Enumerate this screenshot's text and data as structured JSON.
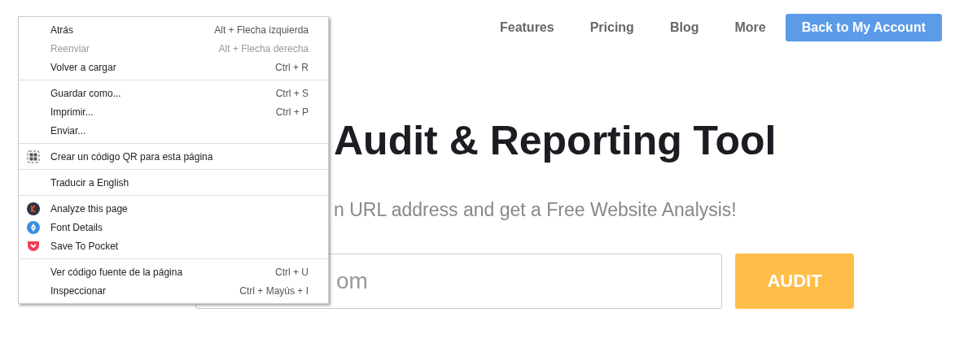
{
  "nav": {
    "links": [
      "Features",
      "Pricing",
      "Blog",
      "More"
    ],
    "account_button": "Back to My Account"
  },
  "hero": {
    "title": "Audit & Reporting Tool",
    "subtitle": "n URL address and get a Free Website Analysis!",
    "url_field": {
      "placeholder": "om"
    },
    "audit_button": "AUDIT"
  },
  "context_menu": {
    "sections": [
      [
        {
          "label": "Atrás",
          "shortcut": "Alt + Flecha izquierda",
          "disabled": false
        },
        {
          "label": "Reenviar",
          "shortcut": "Alt + Flecha derecha",
          "disabled": true
        },
        {
          "label": "Volver a cargar",
          "shortcut": "Ctrl + R",
          "disabled": false
        }
      ],
      [
        {
          "label": "Guardar como...",
          "shortcut": "Ctrl + S",
          "disabled": false
        },
        {
          "label": "Imprimir...",
          "shortcut": "Ctrl + P",
          "disabled": false
        },
        {
          "label": "Enviar...",
          "disabled": false
        }
      ],
      [
        {
          "label": "Crear un código QR para esta página",
          "kind": "qr",
          "disabled": false
        }
      ],
      [
        {
          "label": "Traducir a English",
          "disabled": false
        }
      ],
      [
        {
          "label": "Analyze this page",
          "kind": "k-logo",
          "disabled": false
        },
        {
          "label": "Font Details",
          "kind": "pen-nib",
          "disabled": false
        },
        {
          "label": "Save To Pocket",
          "kind": "pocket",
          "disabled": false
        }
      ],
      [
        {
          "label": "Ver código fuente de la página",
          "shortcut": "Ctrl + U",
          "disabled": false
        },
        {
          "label": "Inspeccionar",
          "shortcut": "Ctrl + Mayús + I",
          "disabled": false
        }
      ]
    ]
  }
}
